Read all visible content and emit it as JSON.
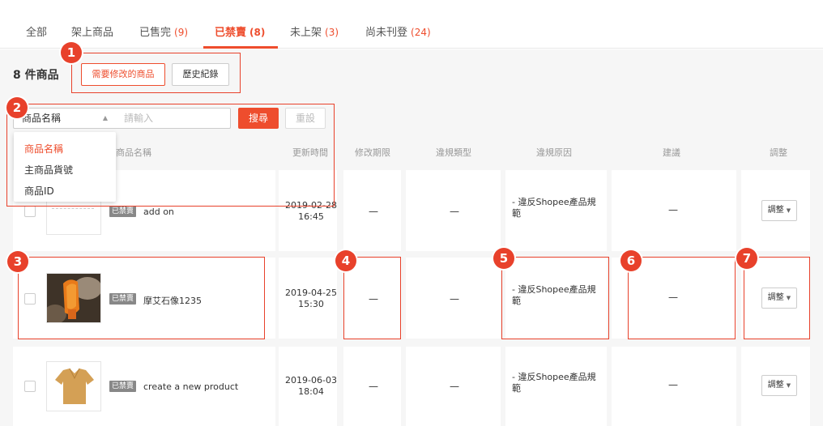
{
  "tabs": [
    {
      "label": "全部",
      "count": ""
    },
    {
      "label": "架上商品",
      "count": ""
    },
    {
      "label": "已售完",
      "count": "(9)"
    },
    {
      "label": "已禁賣",
      "count": "(8)"
    },
    {
      "label": "未上架",
      "count": "(3)"
    },
    {
      "label": "尚未刊登",
      "count": "(24)"
    }
  ],
  "toolbar": {
    "count_title": "8 件商品",
    "needs_edit_label": "需要修改的商品",
    "history_label": "歷史紀錄"
  },
  "search": {
    "field_selected": "商品名稱",
    "placeholder": "請輸入",
    "search_label": "搜尋",
    "reset_label": "重設",
    "options": [
      "商品名稱",
      "主商品貨號",
      "商品ID"
    ]
  },
  "table": {
    "headers": {
      "name": "商品名稱",
      "updated": "更新時間",
      "deadline": "修改期限",
      "violation_type": "違規類型",
      "violation_reason": "違規原因",
      "suggestion": "建議",
      "adjust": "調整"
    },
    "banned_tag": "已禁賣",
    "adjust_label": "調整",
    "rows": [
      {
        "name": "add on",
        "date": "2019-02-28",
        "time": "16:45",
        "deadline": "—",
        "violation_type": "—",
        "reason_line1": "- 違反Shopee產品規",
        "reason_line2": "範",
        "suggestion": "—"
      },
      {
        "name": "摩艾石像1235",
        "date": "2019-04-25",
        "time": "15:30",
        "deadline": "—",
        "violation_type": "—",
        "reason_line1": "- 違反Shopee產品規",
        "reason_line2": "範",
        "suggestion": "—"
      },
      {
        "name": "create a new product",
        "date": "2019-06-03",
        "time": "18:04",
        "deadline": "—",
        "violation_type": "—",
        "reason_line1": "- 違反Shopee產品規",
        "reason_line2": "範",
        "suggestion": "—"
      }
    ]
  },
  "annotations": [
    "1",
    "2",
    "3",
    "4",
    "5",
    "6",
    "7"
  ],
  "colors": {
    "accent": "#ee4d2d",
    "annotation": "#e8412b",
    "banned_tag": "#888888"
  },
  "icons": {
    "select_arrow": "caret-up-icon",
    "adjust_caret": "caret-down-icon"
  }
}
